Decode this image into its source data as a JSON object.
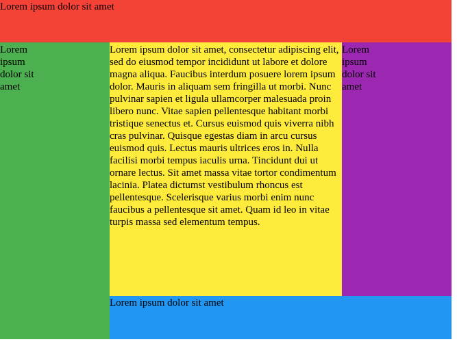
{
  "header": {
    "text": "Lorem ipsum dolor sit amet",
    "color": "#f44336"
  },
  "left_sidebar": {
    "text": "Lorem ipsum dolor sit amet",
    "color": "#4caf50"
  },
  "main": {
    "text": "Lorem ipsum dolor sit amet, consectetur adipiscing elit, sed do eiusmod tempor incididunt ut labore et dolore magna aliqua. Faucibus interdum posuere lorem ipsum dolor. Mauris in aliquam sem fringilla ut morbi. Nunc pulvinar sapien et ligula ullamcorper malesuada proin libero nunc. Vitae sapien pellentesque habitant morbi tristique senectus et. Cursus euismod quis viverra nibh cras pulvinar. Quisque egestas diam in arcu cursus euismod quis. Lectus mauris ultrices eros in. Nulla facilisi morbi tempus iaculis urna. Tincidunt dui ut ornare lectus. Sit amet massa vitae tortor condimentum lacinia. Platea dictumst vestibulum rhoncus est pellentesque. Scelerisque varius morbi enim nunc faucibus a pellentesque sit amet. Quam id leo in vitae turpis massa sed elementum tempus.",
    "color": "#ffeb3b"
  },
  "right_sidebar": {
    "text": "Lorem ipsum dolor sit amet",
    "color": "#9c27b0"
  },
  "footer": {
    "text": "Lorem ipsum dolor sit amet",
    "color": "#2196f3"
  }
}
